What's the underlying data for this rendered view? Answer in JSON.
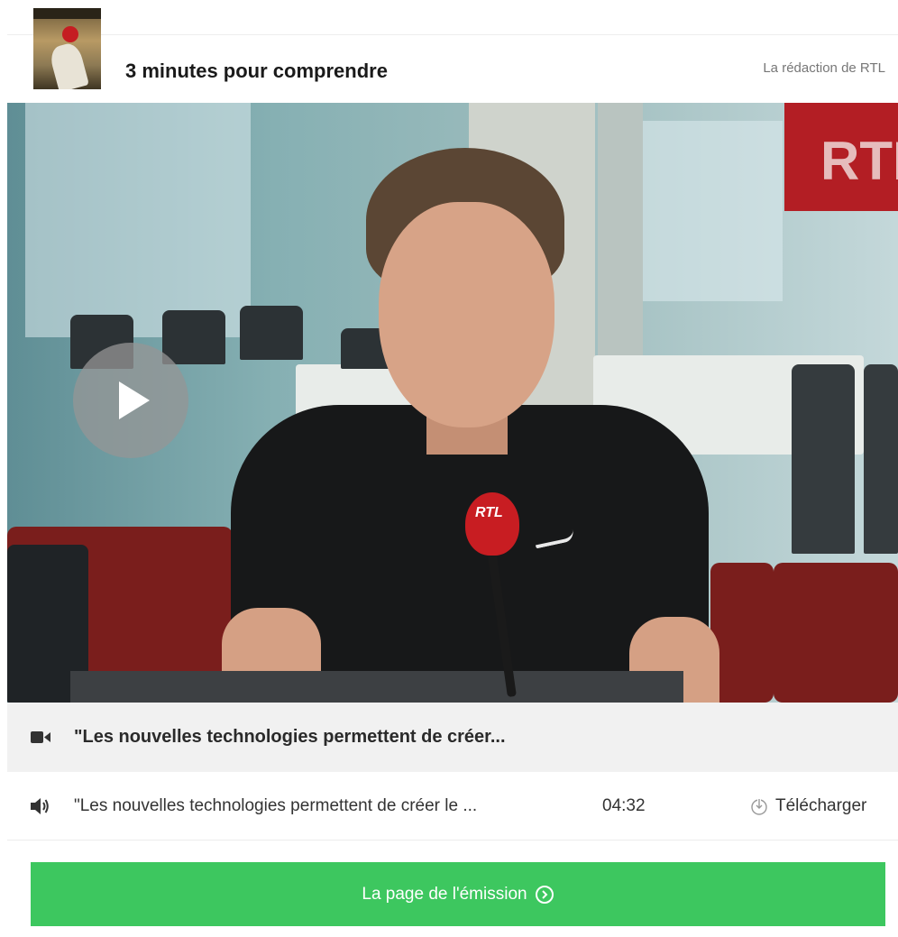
{
  "header": {
    "show_title": "3 minutes pour comprendre",
    "author": "La rédaction de RTL"
  },
  "video": {
    "sign_text": "RTL",
    "mic_text": "RTL",
    "title": "\"Les nouvelles technologies permettent de créer..."
  },
  "audio": {
    "title": "\"Les nouvelles technologies permettent de créer le ...",
    "duration": "04:32",
    "download_label": "Télécharger"
  },
  "cta": {
    "label": "La page de l'émission"
  },
  "colors": {
    "cta_background": "#3dc75f",
    "title_bar_background": "#f1f1f1",
    "play_button": "#969696",
    "rtl_red": "#c81d22"
  },
  "icons": {
    "video": "video-camera-icon",
    "audio": "speaker-icon",
    "download": "download-icon",
    "cta": "chevron-circle-right-icon",
    "play": "play-icon"
  }
}
